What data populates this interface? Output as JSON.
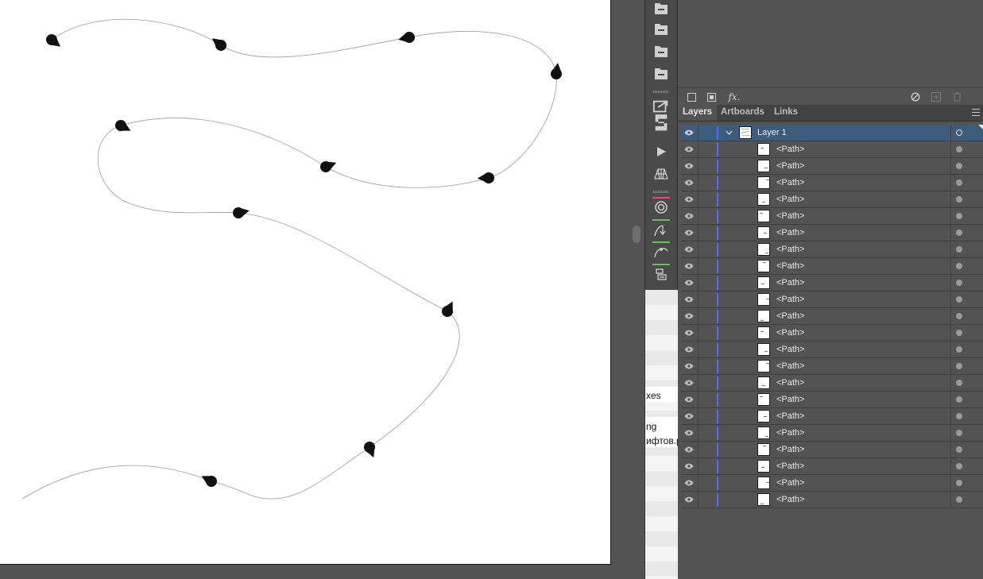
{
  "layers_panel": {
    "tabs": [
      {
        "label": "Layers",
        "active": true
      },
      {
        "label": "Artboards",
        "active": false
      },
      {
        "label": "Links",
        "active": false
      }
    ],
    "layer": {
      "name": "Layer 1",
      "expanded": true,
      "selected": true
    },
    "items": [
      "<Path>",
      "<Path>",
      "<Path>",
      "<Path>",
      "<Path>",
      "<Path>",
      "<Path>",
      "<Path>",
      "<Path>",
      "<Path>",
      "<Path>",
      "<Path>",
      "<Path>",
      "<Path>",
      "<Path>",
      "<Path>",
      "<Path>",
      "<Path>",
      "<Path>",
      "<Path>",
      "<Path>",
      "<Path>"
    ]
  },
  "upper_panel": {
    "fx_label": "fx."
  },
  "background_window": {
    "fragments": [
      "xes",
      "ng",
      "ифтов.р"
    ]
  },
  "colors": {
    "selected_row": "#3d5c7d",
    "layer_color": "#4d6fff",
    "panel_bg": "#535353"
  },
  "icons": [
    "folder-icon",
    "eye-icon",
    "chevron-down-icon",
    "clear-appearance-icon",
    "new-style-icon",
    "trash-icon",
    "panel-menu-icon",
    "play-icon",
    "mesh-icon"
  ]
}
